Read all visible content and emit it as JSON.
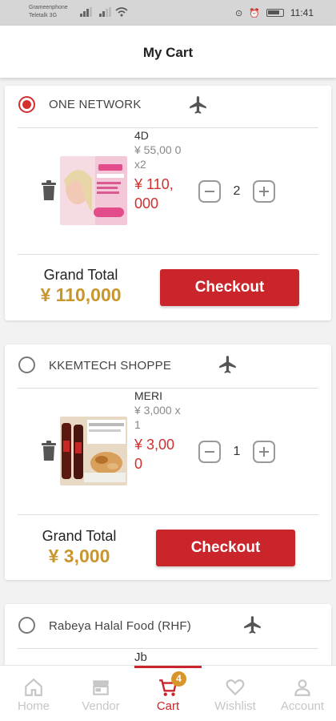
{
  "status_bar": {
    "carrier_line1": "Grameenphone",
    "carrier_line2": "Teletalk 3G",
    "time": "11:41",
    "icons": [
      "signal-icon",
      "wifi-icon",
      "vibrate-icon",
      "alarm-icon",
      "battery-icon"
    ]
  },
  "header": {
    "title": "My Cart"
  },
  "stores": [
    {
      "name": "ONE NETWORK",
      "selected": true,
      "item": {
        "name": "4D",
        "price_line": "¥ 55,00 0x2",
        "total": "¥ 110, 000",
        "quantity": "2"
      },
      "grand_total_label": "Grand Total",
      "grand_total": "¥ 110,000",
      "checkout_label": "Checkout"
    },
    {
      "name": "KKEMTECH SHOPPE",
      "selected": false,
      "item": {
        "name": "MERI",
        "price_line": "¥ 3,000 x1",
        "total": "¥ 3,00 0",
        "quantity": "1"
      },
      "grand_total_label": "Grand Total",
      "grand_total": "¥ 3,000",
      "checkout_label": "Checkout"
    },
    {
      "name": "Rabeya Halal Food (RHF)",
      "selected": false,
      "item": {
        "name": "Jb"
      }
    }
  ],
  "bottom_nav": {
    "items": [
      {
        "label": "Home",
        "icon": "home-icon"
      },
      {
        "label": "Vendor",
        "icon": "store-icon"
      },
      {
        "label": "Cart",
        "icon": "cart-icon",
        "badge": "4"
      },
      {
        "label": "Wishlist",
        "icon": "heart-icon"
      },
      {
        "label": "Account",
        "icon": "person-icon"
      }
    ],
    "active": "Cart"
  },
  "colors": {
    "accent": "#c9252b",
    "total": "#c9962e",
    "badge": "#d8952a"
  }
}
